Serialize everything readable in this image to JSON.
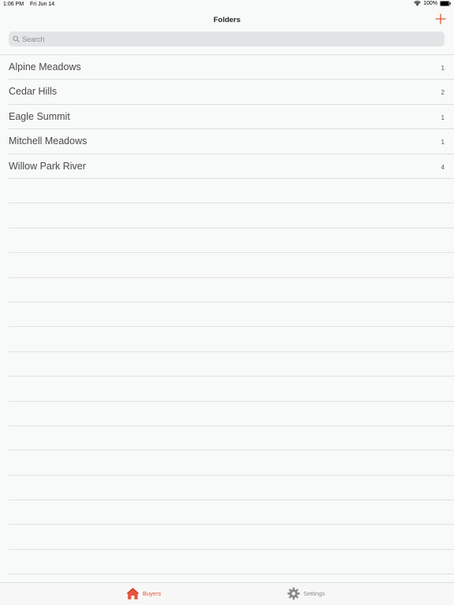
{
  "status_bar": {
    "time": "1:06 PM",
    "date": "Fri Jun 14",
    "battery": "100%"
  },
  "nav": {
    "title": "Folders",
    "add_icon": "plus-icon"
  },
  "search": {
    "placeholder": "Search",
    "value": ""
  },
  "folders": [
    {
      "name": "Alpine Meadows",
      "count": "1"
    },
    {
      "name": "Cedar Hills",
      "count": "2"
    },
    {
      "name": "Eagle Summit",
      "count": "1"
    },
    {
      "name": "Mitchell Meadows",
      "count": "1"
    },
    {
      "name": "Willow Park River",
      "count": "4"
    }
  ],
  "tabs": [
    {
      "label": "Buyers",
      "icon": "house-icon",
      "selected": true
    },
    {
      "label": "Settings",
      "icon": "gear-icon",
      "selected": false
    }
  ],
  "colors": {
    "accent": "#e8533b",
    "inactive": "#8a8a8a"
  }
}
